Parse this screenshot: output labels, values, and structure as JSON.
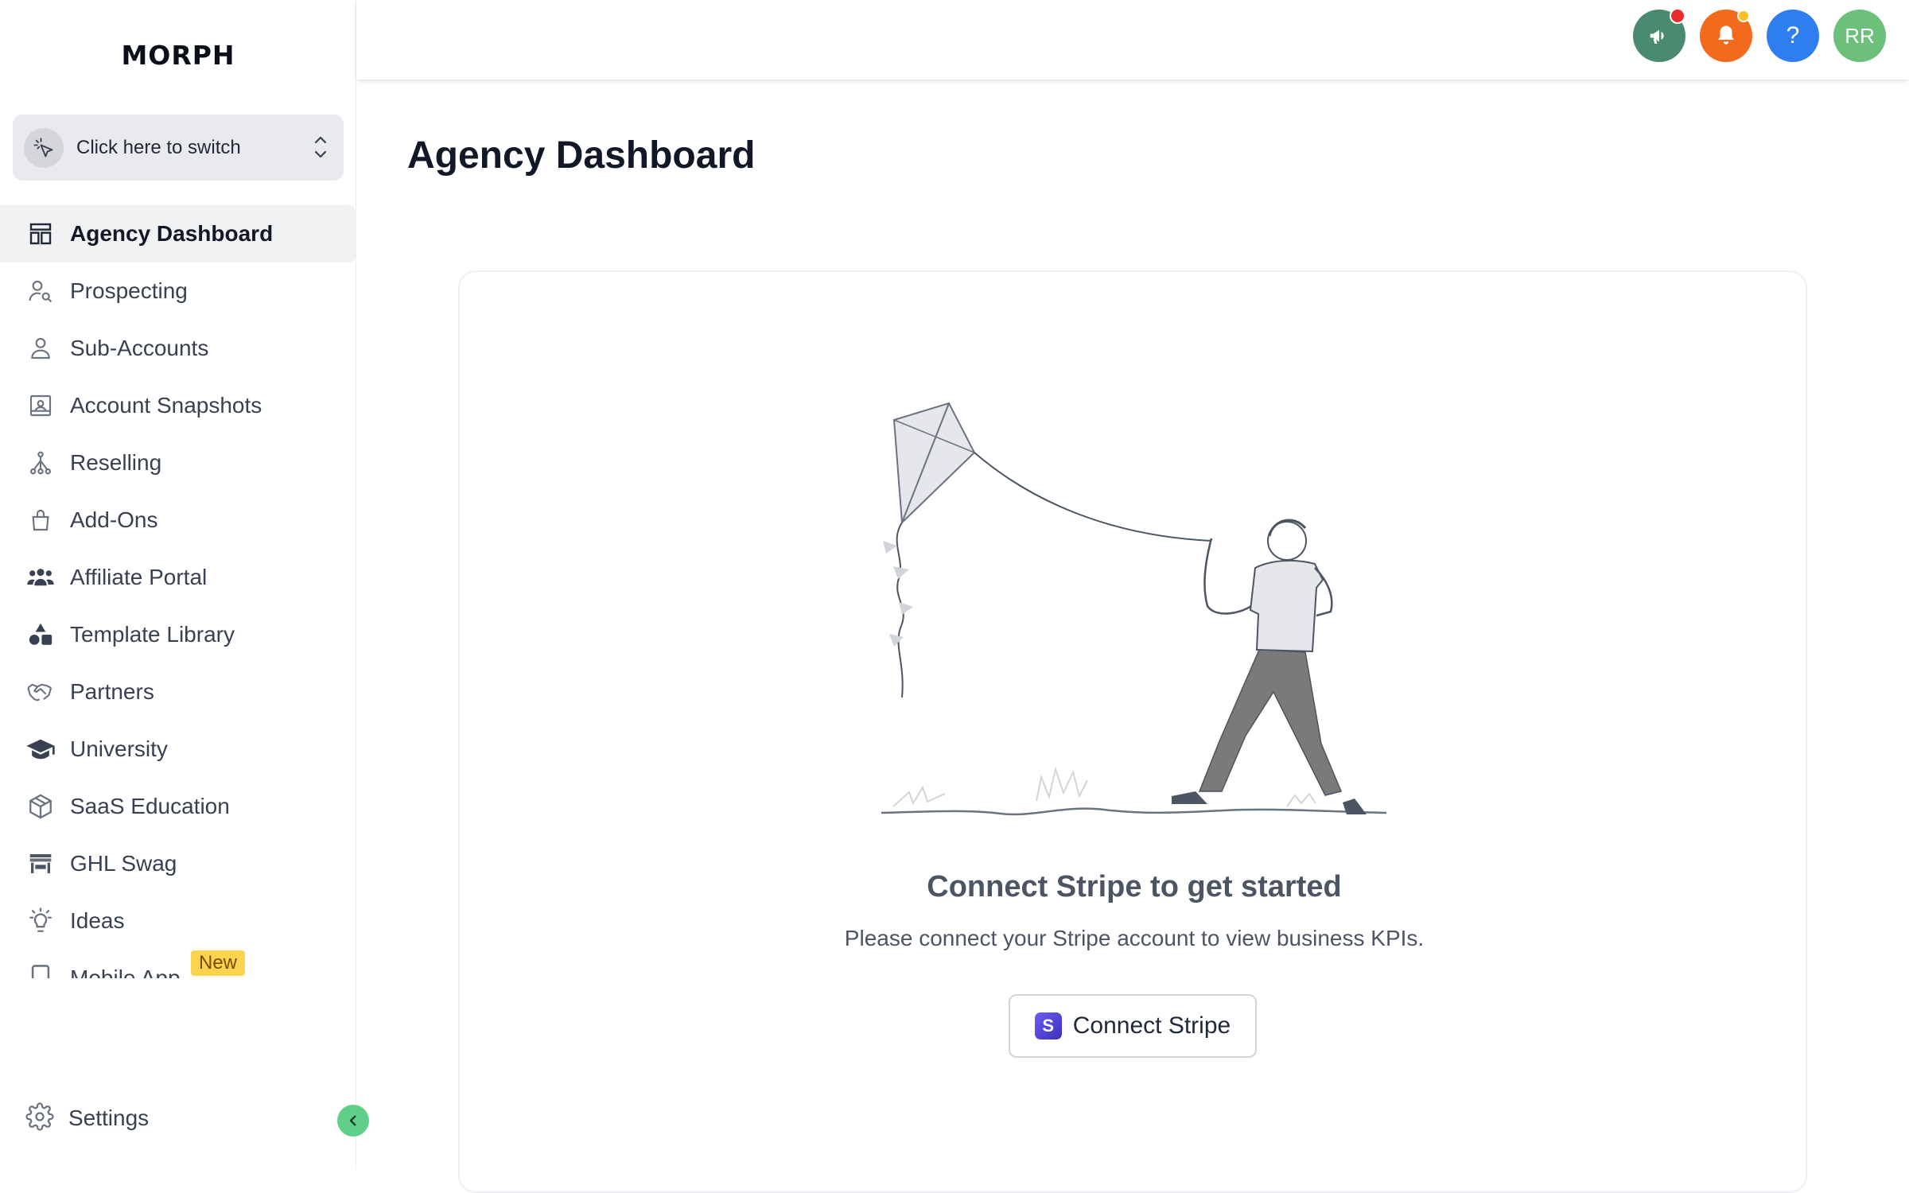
{
  "sidebar": {
    "logo": "MORPH",
    "switcher_label": "Click here to switch",
    "items": [
      {
        "label": "Agency Dashboard",
        "icon": "dashboard-icon",
        "active": true
      },
      {
        "label": "Prospecting",
        "icon": "user-search-icon"
      },
      {
        "label": "Sub-Accounts",
        "icon": "user-icon"
      },
      {
        "label": "Account Snapshots",
        "icon": "snapshot-icon"
      },
      {
        "label": "Reselling",
        "icon": "network-icon"
      },
      {
        "label": "Add-Ons",
        "icon": "shopping-bag-icon"
      },
      {
        "label": "Affiliate Portal",
        "icon": "users-icon"
      },
      {
        "label": "Template Library",
        "icon": "shapes-icon"
      },
      {
        "label": "Partners",
        "icon": "handshake-icon"
      },
      {
        "label": "University",
        "icon": "graduation-cap-icon"
      },
      {
        "label": "SaaS Education",
        "icon": "box-icon"
      },
      {
        "label": "GHL Swag",
        "icon": "store-icon"
      },
      {
        "label": "Ideas",
        "icon": "lightbulb-icon"
      },
      {
        "label": "Mobile App",
        "icon": "mobile-icon",
        "badge": "New"
      }
    ],
    "settings_label": "Settings"
  },
  "topbar": {
    "avatar_initials": "RR",
    "help_label": "?",
    "colors": {
      "announce": "#4a8a6e",
      "bell": "#f26b1d",
      "help": "#2f7ef0",
      "avatar": "#6cc07a"
    }
  },
  "main": {
    "title": "Agency Dashboard",
    "empty_title": "Connect Stripe to get started",
    "empty_subtitle": "Please connect your Stripe account to view business KPIs.",
    "connect_button": "Connect Stripe",
    "stripe_logo_letter": "S"
  }
}
